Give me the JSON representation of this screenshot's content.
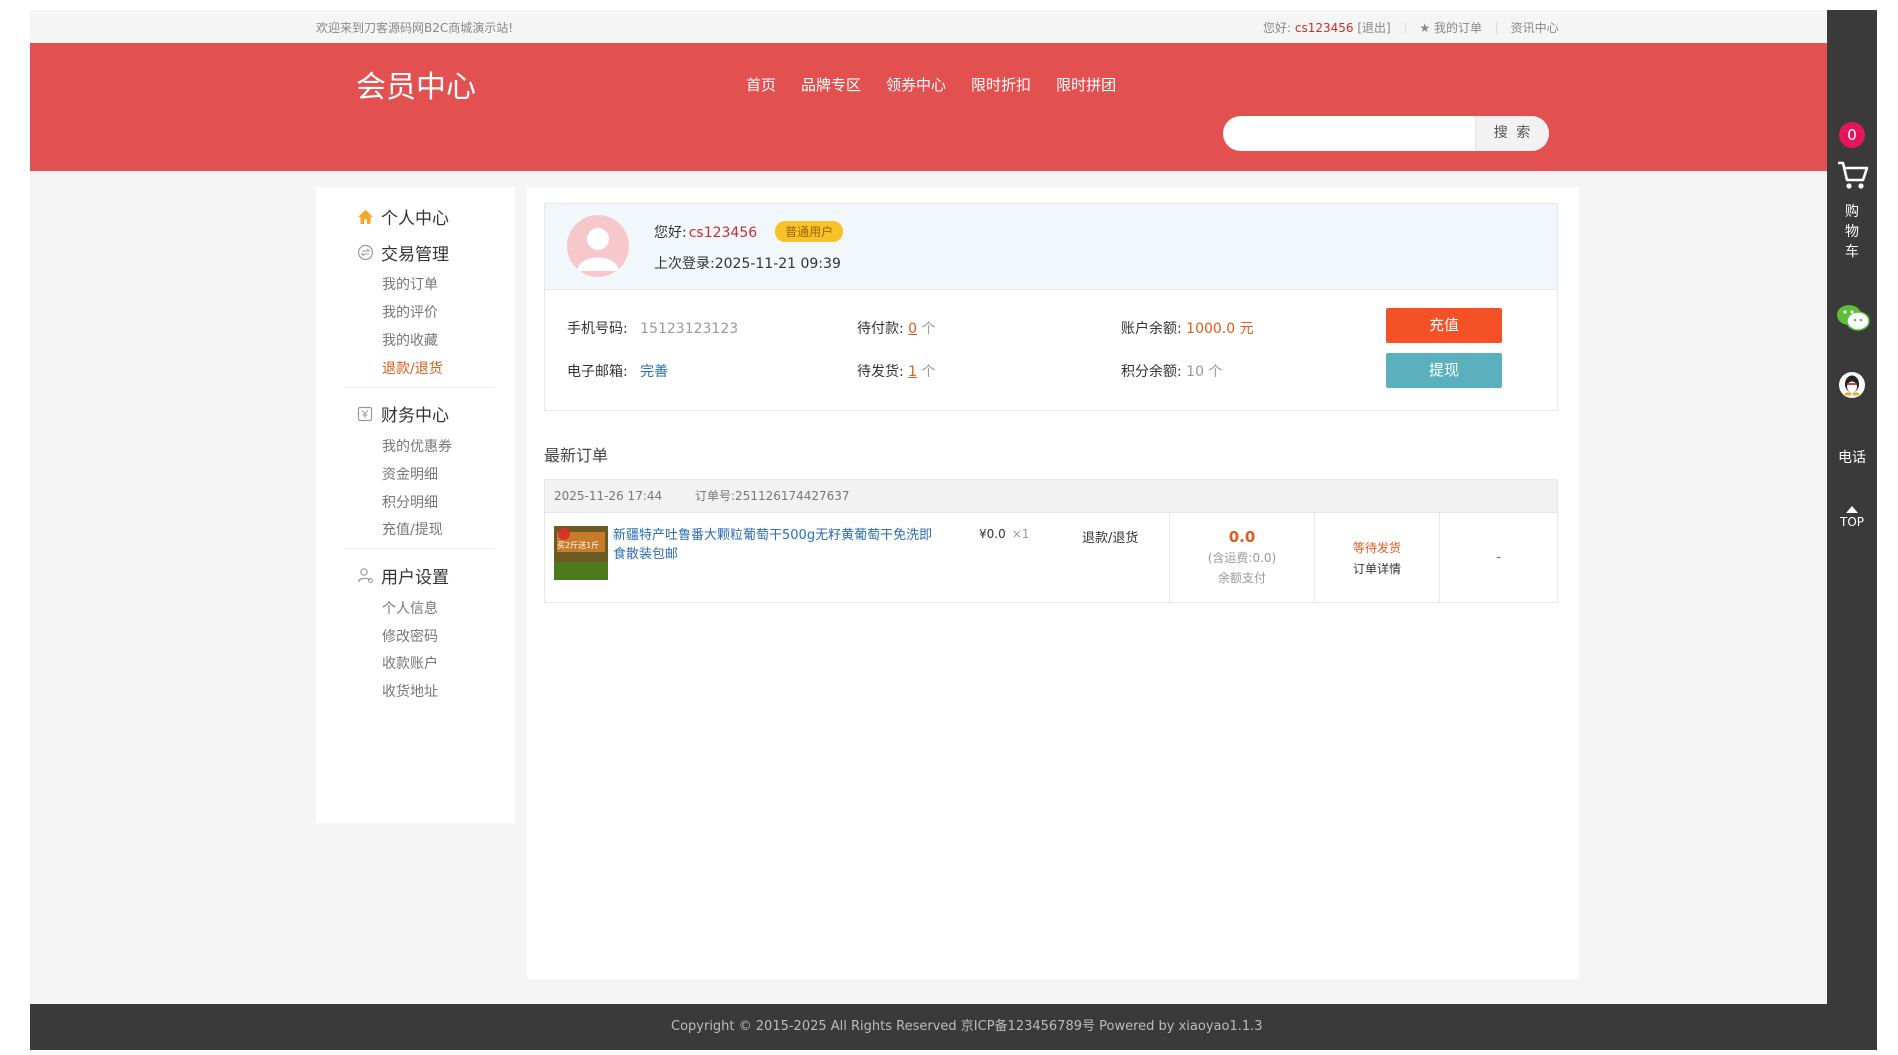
{
  "topbar": {
    "welcome": "欢迎来到刀客源码网B2C商城演示站!",
    "greeting": "您好:",
    "username": "cs123456",
    "logout": "[退出]",
    "my_orders": "我的订单",
    "news": "资讯中心"
  },
  "header": {
    "brand": "会员中心",
    "nav": [
      "首页",
      "品牌专区",
      "领券中心",
      "限时折扣",
      "限时拼团"
    ],
    "search": {
      "placeholder": "",
      "button": "搜 索"
    }
  },
  "sidebar": {
    "personal_center": "个人中心",
    "trade": {
      "title": "交易管理",
      "items": [
        "我的订单",
        "我的评价",
        "我的收藏",
        "退款/退货"
      ],
      "active_index": 3
    },
    "finance": {
      "title": "财务中心",
      "items": [
        "我的优惠券",
        "资金明细",
        "积分明细",
        "充值/提现"
      ]
    },
    "user_settings": {
      "title": "用户设置",
      "items": [
        "个人信息",
        "修改密码",
        "收款账户",
        "收货地址"
      ]
    }
  },
  "profile": {
    "hello_label": "您好:",
    "username": "cs123456",
    "badge": "普通用户",
    "last_login": "上次登录:2025-11-21 09:39",
    "phone_label": "手机号码:",
    "phone": "15123123123",
    "email_label": "电子邮箱:",
    "email_action": "完善",
    "pending_pay_label": "待付款:",
    "pending_pay": "0",
    "pending_ship_label": "待发货:",
    "pending_ship": "1",
    "count_unit": "个",
    "balance_label": "账户余额:",
    "balance": "1000.0 元",
    "points_label": "积分余额:",
    "points": "10 个",
    "recharge": "充值",
    "withdraw": "提现"
  },
  "orders": {
    "title": "最新订单",
    "list": [
      {
        "time": "2025-11-26 17:44",
        "order_no": "订单号:251126174427637",
        "product": "新疆特产吐鲁番大颗粒葡萄干500g无籽黄葡萄干免洗即食散装包邮",
        "thumb_text": "买2斤送1斤",
        "price": "¥0.0",
        "qty": "×1",
        "refund": "退款/退货",
        "total": "0.0",
        "shipping_fee": "(含运费:0.0)",
        "pay_method": "余额支付",
        "status": "等待发货",
        "detail": "订单详情",
        "extra": "-"
      }
    ]
  },
  "right_bar": {
    "cart_count": "0",
    "cart_label": "购物车",
    "phone": "电话",
    "top": "TOP"
  },
  "footer": {
    "copyright": "Copyright © 2015-2025 All Rights Reserved 京ICP备123456789号   Powered by xiaoyao1.1.3"
  },
  "colors": {
    "header_red": "#e25050",
    "accent_orange": "#e25a1c",
    "recharge_btn": "#f45226",
    "withdraw_btn": "#5ab1bd",
    "badge_yellow": "#f6c42a",
    "dark_bar": "#3a3a3a"
  }
}
